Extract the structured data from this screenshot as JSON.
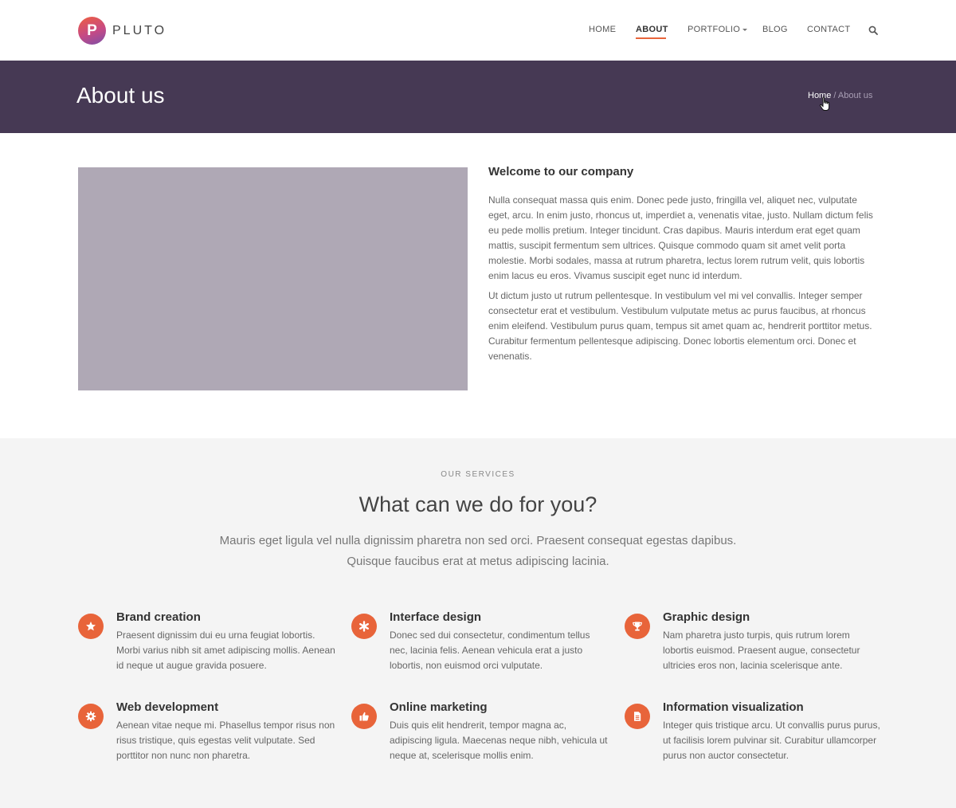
{
  "brand": {
    "logo_letter": "P",
    "name": "PLUTO"
  },
  "nav": {
    "items": [
      {
        "label": "HOME"
      },
      {
        "label": "ABOUT",
        "active": true
      },
      {
        "label": "PORTFOLIO",
        "dropdown": true
      },
      {
        "label": "BLOG"
      },
      {
        "label": "CONTACT"
      }
    ],
    "search_icon": "search-icon"
  },
  "page_header": {
    "title": "About us",
    "breadcrumb_home": "Home",
    "breadcrumb_separator": " / ",
    "breadcrumb_current": "About us"
  },
  "about": {
    "heading": "Welcome to our company",
    "paragraph1": "Nulla consequat massa quis enim. Donec pede justo, fringilla vel, aliquet nec, vulputate eget, arcu. In enim justo, rhoncus ut, imperdiet a, venenatis vitae, justo. Nullam dictum felis eu pede mollis pretium. Integer tincidunt. Cras dapibus. Mauris interdum erat eget quam mattis, suscipit fermentum sem ultrices. Quisque commodo quam sit amet velit porta molestie. Morbi sodales, massa at rutrum pharetra, lectus lorem rutrum velit, quis lobortis enim lacus eu eros. Vivamus suscipit eget nunc id interdum.",
    "paragraph2": "Ut dictum justo ut rutrum pellentesque. In vestibulum vel mi vel convallis. Integer semper consectetur erat et vestibulum. Vestibulum vulputate metus ac purus faucibus, at rhoncus enim eleifend. Vestibulum purus quam, tempus sit amet quam ac, hendrerit porttitor metus. Curabitur fermentum pellentesque adipiscing. Donec lobortis elementum orci. Donec et venenatis."
  },
  "services": {
    "kicker": "OUR SERVICES",
    "title": "What can we do for you?",
    "lead": "Mauris eget ligula vel nulla dignissim pharetra non sed orci. Praesent consequat egestas dapibus. Quisque faucibus erat at metus adipiscing lacinia.",
    "accent_color": "#e8643a",
    "items": [
      {
        "icon": "star-icon",
        "title": "Brand creation",
        "text": "Praesent dignissim dui eu urna feugiat lobortis. Morbi varius nibh sit amet adipiscing mollis. Aenean id neque ut augue gravida posuere."
      },
      {
        "icon": "asterisk-icon",
        "title": "Interface design",
        "text": "Donec sed dui consectetur, condimentum tellus nec, lacinia felis. Aenean vehicula erat a justo lobortis, non euismod orci vulputate."
      },
      {
        "icon": "trophy-icon",
        "title": "Graphic design",
        "text": "Nam pharetra justo turpis, quis rutrum lorem lobortis euismod. Praesent augue, consectetur ultricies eros non, lacinia scelerisque ante."
      },
      {
        "icon": "gear-icon",
        "title": "Web development",
        "text": "Aenean vitae neque mi. Phasellus tempor risus non risus tristique, quis egestas velit vulputate. Sed porttitor non nunc non pharetra."
      },
      {
        "icon": "thumbs-up-icon",
        "title": "Online marketing",
        "text": "Duis quis elit hendrerit, tempor magna ac, adipiscing ligula. Maecenas neque nibh, vehicula ut neque at, scelerisque mollis enim."
      },
      {
        "icon": "document-icon",
        "title": "Information visualization",
        "text": "Integer quis tristique arcu. Ut convallis purus purus, ut facilisis lorem pulvinar sit. Curabitur ullamcorper purus non auctor consectetur."
      }
    ]
  }
}
